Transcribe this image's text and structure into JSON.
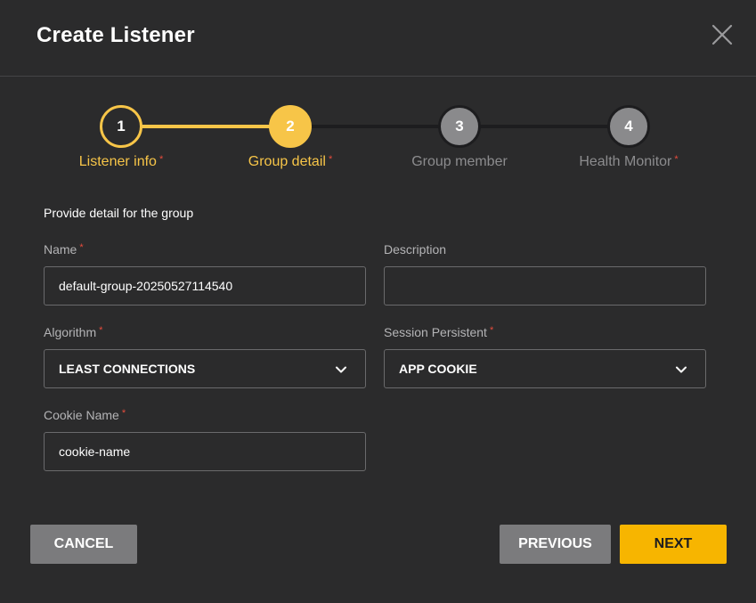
{
  "dialog": {
    "title": "Create Listener",
    "close_icon": "close-icon"
  },
  "stepper": {
    "steps": [
      {
        "number": "1",
        "label": "Listener info",
        "required": "*",
        "state": "done"
      },
      {
        "number": "2",
        "label": "Group detail",
        "required": "*",
        "state": "current"
      },
      {
        "number": "3",
        "label": "Group member",
        "required": "",
        "state": "pending"
      },
      {
        "number": "4",
        "label": "Health Monitor",
        "required": "*",
        "state": "pending"
      }
    ],
    "colors": {
      "active": "#f7c548",
      "pending": "#8a8a8c"
    }
  },
  "form": {
    "section_title": "Provide detail for the group",
    "name": {
      "label": "Name",
      "required": "*",
      "value": "default-group-20250527114540",
      "placeholder": ""
    },
    "description": {
      "label": "Description",
      "value": "",
      "placeholder": ""
    },
    "algorithm": {
      "label": "Algorithm",
      "required": "*",
      "value": "LEAST CONNECTIONS",
      "icon": "chevron-down-icon"
    },
    "session_persistent": {
      "label": "Session Persistent",
      "required": "*",
      "value": "APP COOKIE",
      "icon": "chevron-down-icon"
    },
    "cookie_name": {
      "label": "Cookie Name",
      "required": "*",
      "value": "cookie-name",
      "placeholder": ""
    }
  },
  "footer": {
    "cancel_label": "CANCEL",
    "previous_label": "PREVIOUS",
    "next_label": "NEXT",
    "primary_color": "#f7b500"
  }
}
